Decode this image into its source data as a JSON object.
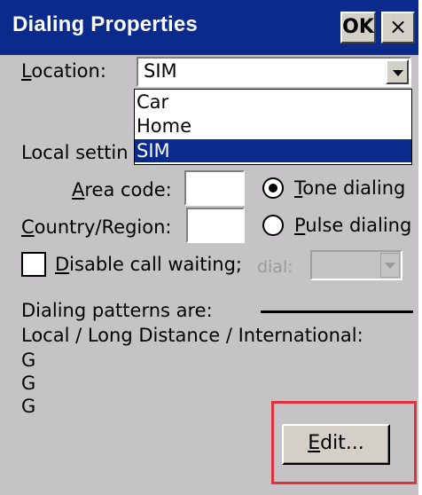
{
  "window": {
    "title": "Dialing Properties",
    "ok_label": "OK",
    "close_glyph": "×"
  },
  "location": {
    "label_mnemonic": "L",
    "label_rest": "ocation:",
    "selected": "SIM",
    "options": [
      "Car",
      "Home",
      "SIM"
    ]
  },
  "local_settings": {
    "label_visible": "Local settin"
  },
  "area_code": {
    "label_mnemonic": "A",
    "label_rest": "rea code:",
    "value": ""
  },
  "country_region": {
    "label_mnemonic": "C",
    "label_rest": "ountry/Region:",
    "value": ""
  },
  "tone_dialing": {
    "label_mnemonic": "T",
    "label_rest": "one dialing",
    "checked": true
  },
  "pulse_dialing": {
    "label_mnemonic": "P",
    "label_rest": "ulse dialing",
    "checked": false
  },
  "disable_call_waiting": {
    "label_mnemonic": "D",
    "label_rest": "isable call waiting;",
    "checked": false
  },
  "dial": {
    "label": "dial:",
    "value": ""
  },
  "patterns": {
    "heading": "Dialing patterns are:",
    "subheading": "Local / Long Distance / International:",
    "values": [
      "G",
      "G",
      "G"
    ]
  },
  "edit_button": {
    "label_mnemonic": "E",
    "label_rest": "dit..."
  },
  "colors": {
    "titlebar": "#0a2a8c",
    "dialog_bg": "#c6c3c6",
    "highlight": "#e0323c"
  }
}
